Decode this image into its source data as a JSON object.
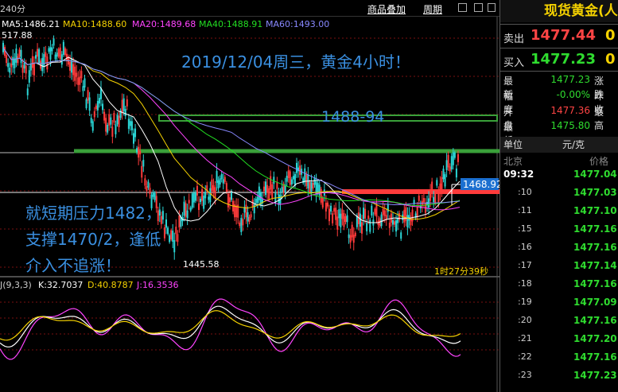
{
  "header": {
    "period": "240分",
    "links": [
      "商品叠加",
      "周期"
    ]
  },
  "ma": [
    {
      "label": "MA5:1486.21",
      "color": "#ffffff"
    },
    {
      "label": "MA10:1488.60",
      "color": "#f5d200"
    },
    {
      "label": "MA20:1489.68",
      "color": "#ff44ff"
    },
    {
      "label": "MA40:1488.91",
      "color": "#22dd22"
    },
    {
      "label": "MA60:1493.00",
      "color": "#8888ff"
    }
  ],
  "chart": {
    "high_label": "517.88",
    "low_label": "1445.58",
    "current_price_tag": "1468.92",
    "countdown": "1时27分39秒",
    "level_1488_94": "1488-94"
  },
  "annotations": {
    "title": "2019/12/04周三，黄金4小时！",
    "body": [
      "就短期压力1482，",
      "支撑1470/2，逢低",
      "介入不追涨！"
    ]
  },
  "kdj": {
    "name": "J(9,3,3)",
    "k": "K:32.7037",
    "d": "D:40.8787",
    "j": "J:16.3536"
  },
  "quote": {
    "title": "现货黄金(人",
    "sell_label": "卖出",
    "sell_price": "1477.44",
    "sell_vol": "0",
    "buy_label": "买入",
    "buy_price": "1477.23",
    "buy_vol": "0",
    "stats": [
      {
        "label": "最新",
        "value": "1477.23",
        "color": "#2fdc2f",
        "label2": "涨跌"
      },
      {
        "label": "幅度",
        "value": "-0.00%",
        "color": "#2fdc2f",
        "label2": "昨收"
      },
      {
        "label": "开盘",
        "value": "1477.36",
        "color": "#ff4444",
        "label2": "最高"
      },
      {
        "label": "最低",
        "value": "1475.80",
        "color": "#2fdc2f",
        "label2": ""
      }
    ],
    "unit_label": "单位",
    "unit_value": "元/克",
    "ticks_header_left": "北京",
    "ticks_header_right": "价格",
    "ticks": [
      {
        "time": "09:32",
        "price": "1477.04"
      },
      {
        "time": ":10",
        "price": "1477.03"
      },
      {
        "time": ":11",
        "price": "1477.10"
      },
      {
        "time": ":15",
        "price": "1477.16"
      },
      {
        "time": ":16",
        "price": "1477.16"
      },
      {
        "time": ":17",
        "price": "1477.14"
      },
      {
        "time": ":18",
        "price": "1477.16"
      },
      {
        "time": ":19",
        "price": "1477.09"
      },
      {
        "time": ":20",
        "price": "1477.16"
      },
      {
        "time": ":21",
        "price": "1477.20"
      },
      {
        "time": ":22",
        "price": "1477.16"
      },
      {
        "time": ":23",
        "price": "1477.23"
      }
    ]
  }
}
